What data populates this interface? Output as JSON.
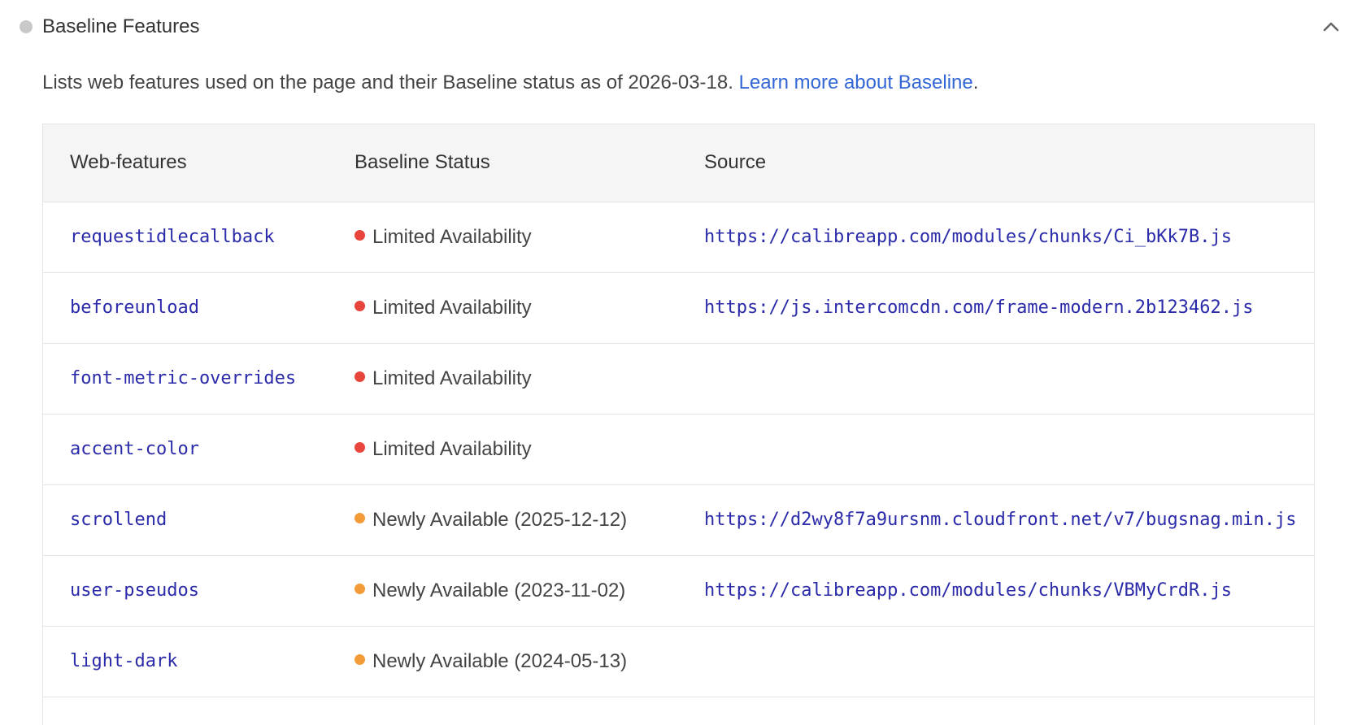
{
  "section": {
    "title": "Baseline Features",
    "status_color": "#c9c9c9",
    "collapse_icon": "chevron-up-icon",
    "description_prefix": "Lists web features used on the page and their Baseline status as of 2026-03-18.",
    "learn_more_link": "Learn more about Baseline",
    "description_suffix": "."
  },
  "table": {
    "headers": {
      "feature": "Web-features",
      "status": "Baseline Status",
      "source": "Source"
    },
    "status_colors": {
      "limited": "#e8453c",
      "newly": "#f29b38"
    },
    "rows": [
      {
        "feature": "requestidlecallback",
        "status": "Limited Availability",
        "status_kind": "limited",
        "source": "https://calibreapp.com/modules/chunks/Ci_bKk7B.js"
      },
      {
        "feature": "beforeunload",
        "status": "Limited Availability",
        "status_kind": "limited",
        "source": "https://js.intercomcdn.com/frame-modern.2b123462.js"
      },
      {
        "feature": "font-metric-overrides",
        "status": "Limited Availability",
        "status_kind": "limited",
        "source": ""
      },
      {
        "feature": "accent-color",
        "status": "Limited Availability",
        "status_kind": "limited",
        "source": ""
      },
      {
        "feature": "scrollend",
        "status": "Newly Available (2025-12-12)",
        "status_kind": "newly",
        "source": "https://d2wy8f7a9ursnm.cloudfront.net/v7/bugsnag.min.js"
      },
      {
        "feature": "user-pseudos",
        "status": "Newly Available (2023-11-02)",
        "status_kind": "newly",
        "source": "https://calibreapp.com/modules/chunks/VBMyCrdR.js"
      },
      {
        "feature": "light-dark",
        "status": "Newly Available (2024-05-13)",
        "status_kind": "newly",
        "source": ""
      }
    ]
  }
}
